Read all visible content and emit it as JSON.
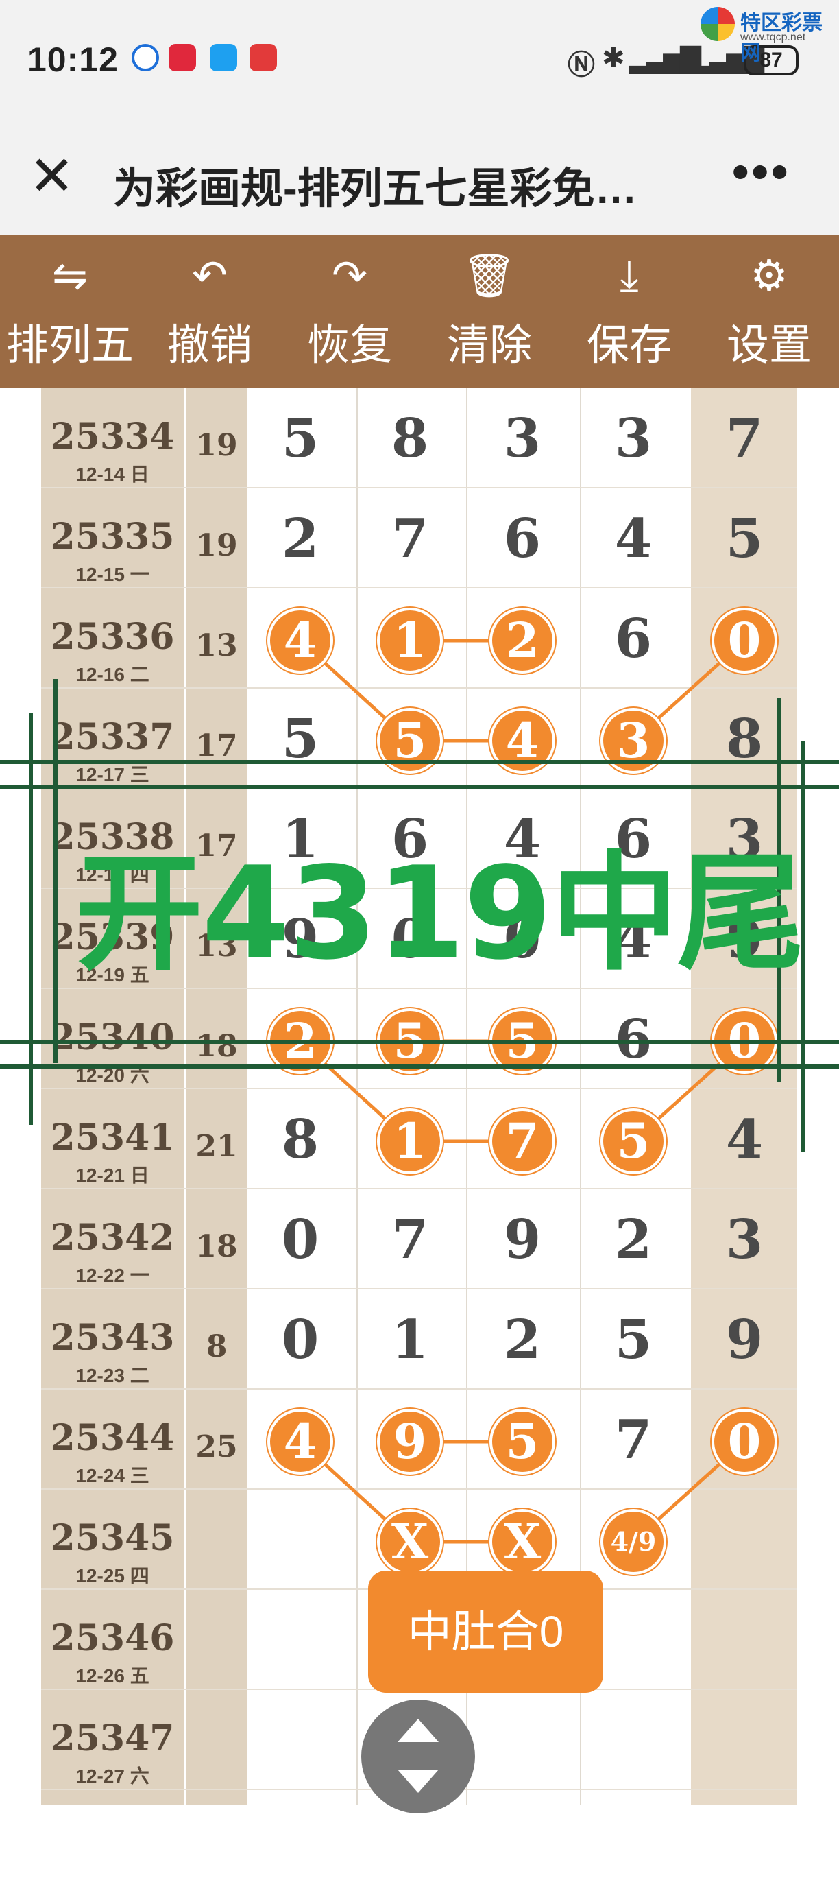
{
  "status": {
    "time": "10:12",
    "battery": "87",
    "signal_icons": [
      "nfc-icon",
      "bluetooth-icon",
      "signal-icon",
      "signal-icon"
    ],
    "watermark_name": "特区彩票网",
    "watermark_url": "www.tqcp.net"
  },
  "titlebar": {
    "title": "为彩画规-排列五七星彩免…"
  },
  "toolbar": {
    "items": [
      {
        "label": "排列五",
        "icon": "swap-icon"
      },
      {
        "label": "撤销",
        "icon": "undo-icon"
      },
      {
        "label": "恢复",
        "icon": "redo-icon"
      },
      {
        "label": "清除",
        "icon": "trash-icon"
      },
      {
        "label": "保存",
        "icon": "download-icon"
      },
      {
        "label": "设置",
        "icon": "gear-icon"
      }
    ]
  },
  "board": {
    "rows": [
      {
        "period": "25334",
        "date": "12-14 日",
        "sum": "19",
        "digits": [
          "5",
          "8",
          "3",
          "3",
          "7"
        ]
      },
      {
        "period": "25335",
        "date": "12-15 一",
        "sum": "19",
        "digits": [
          "2",
          "7",
          "6",
          "4",
          "5"
        ]
      },
      {
        "period": "25336",
        "date": "12-16 二",
        "sum": "13",
        "digits": [
          "4",
          "1",
          "2",
          "6",
          "0"
        ]
      },
      {
        "period": "25337",
        "date": "12-17 三",
        "sum": "17",
        "digits": [
          "5",
          "5",
          "4",
          "3",
          "8"
        ]
      },
      {
        "period": "25338",
        "date": "12-18 四",
        "sum": "17",
        "digits": [
          "1",
          "6",
          "4",
          "6",
          "3"
        ]
      },
      {
        "period": "25339",
        "date": "12-19 五",
        "sum": "13",
        "digits": [
          "9",
          "0",
          "0",
          "4",
          "9"
        ]
      },
      {
        "period": "25340",
        "date": "12-20 六",
        "sum": "18",
        "digits": [
          "2",
          "5",
          "5",
          "6",
          "0"
        ]
      },
      {
        "period": "25341",
        "date": "12-21 日",
        "sum": "21",
        "digits": [
          "8",
          "1",
          "7",
          "5",
          "4"
        ]
      },
      {
        "period": "25342",
        "date": "12-22 一",
        "sum": "18",
        "digits": [
          "0",
          "7",
          "9",
          "2",
          "3"
        ]
      },
      {
        "period": "25343",
        "date": "12-23 二",
        "sum": "8",
        "digits": [
          "0",
          "1",
          "2",
          "5",
          "9"
        ]
      },
      {
        "period": "25344",
        "date": "12-24 三",
        "sum": "25",
        "digits": [
          "4",
          "9",
          "5",
          "7",
          "0"
        ]
      },
      {
        "period": "25345",
        "date": "12-25 四",
        "sum": "",
        "digits": [
          "",
          "X",
          "X",
          "4/9",
          ""
        ]
      },
      {
        "period": "25346",
        "date": "12-26 五",
        "sum": "",
        "digits": [
          "",
          "",
          "",
          "",
          ""
        ]
      },
      {
        "period": "25347",
        "date": "12-27 六",
        "sum": "",
        "digits": [
          "",
          "",
          "",
          "",
          ""
        ]
      }
    ],
    "overlay_text": "开4319中尾",
    "pill_label": "中肚合0"
  },
  "colors": {
    "toolbar_bg": "#9b6b44",
    "ball": "#f28a2e",
    "overlay_text": "#1fa84a",
    "frame_lines": "#1f5a35",
    "period_col": "#dfd2bf"
  }
}
